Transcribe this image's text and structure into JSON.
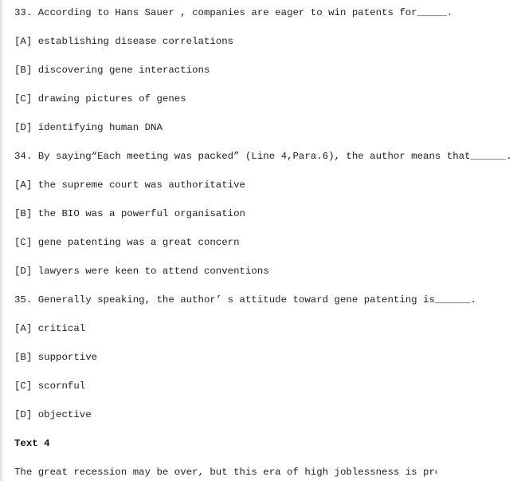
{
  "questions": [
    {
      "stem": "33. According to Hans Sauer , companies are eager to win patents for_____.",
      "options": [
        "[A] establishing disease correlations",
        "[B] discovering gene interactions",
        "[C] drawing pictures of genes",
        "[D] identifying human DNA"
      ]
    },
    {
      "stem": "34. By saying“Each meeting was packed” (Line 4,Para.6), the author means that______.",
      "options": [
        "[A] the supreme court was authoritative",
        "[B] the BIO was a powerful organisation",
        "[C] gene patenting was a great concern",
        "[D] lawyers were keen to attend conventions"
      ]
    },
    {
      "stem": "35. Generally speaking, the author’ s attitude toward gene patenting is______.",
      "options": [
        "[A] critical",
        "[B] supportive",
        "[C] scornful",
        "[D] objective"
      ]
    }
  ],
  "section": {
    "heading": "Text 4",
    "first_line": "The great recession may be over, but this era of high joblessness is probab"
  }
}
